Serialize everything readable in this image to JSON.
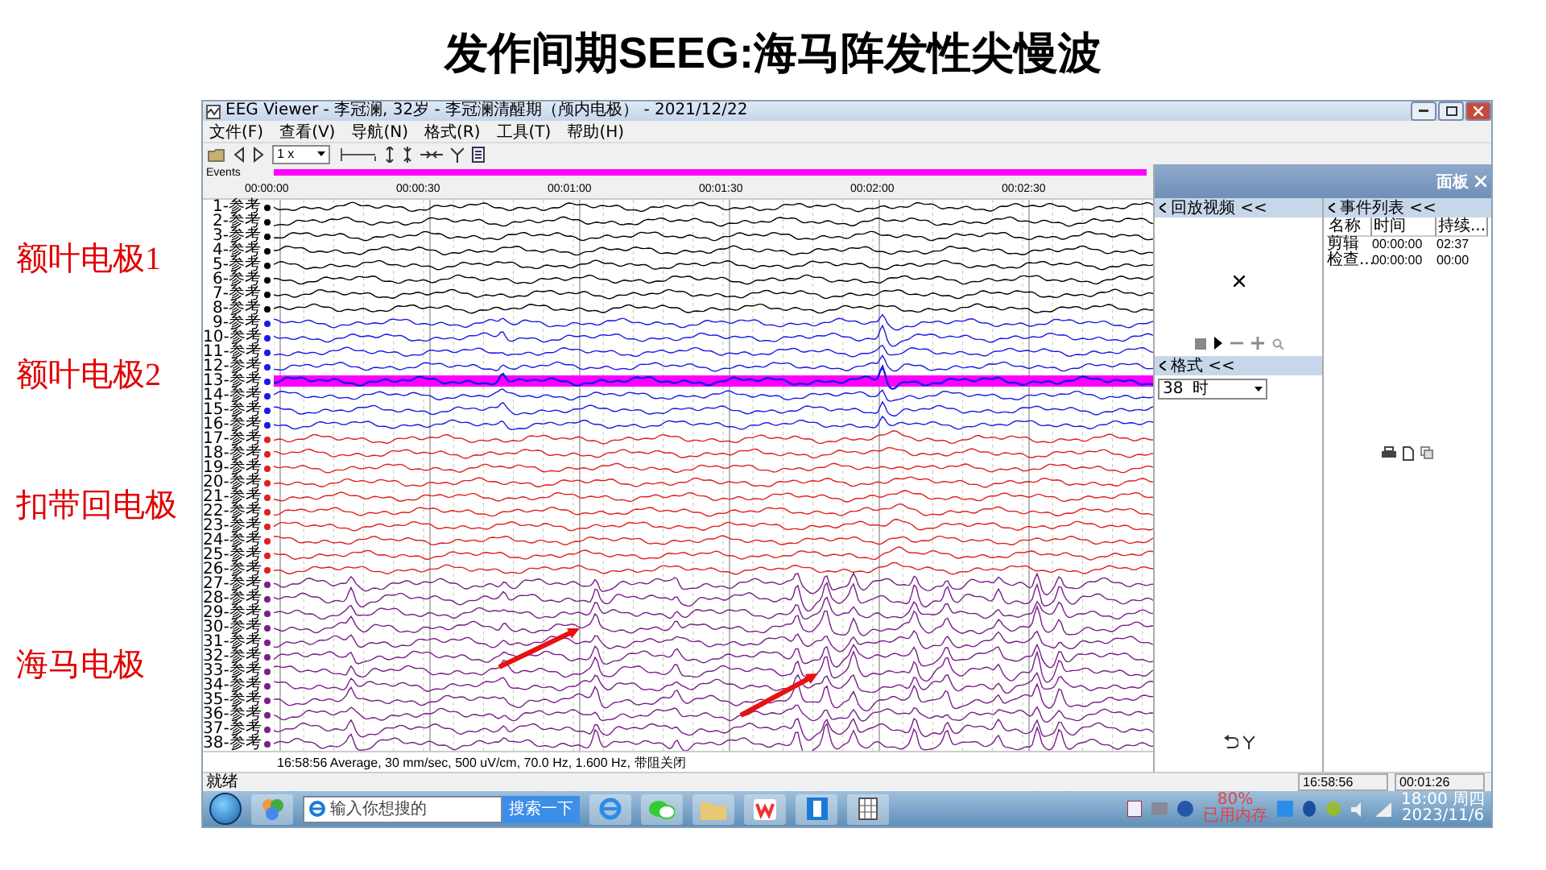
{
  "slide_title": "发作间期SEEG:海马阵发性尖慢波",
  "electrode_groups": [
    {
      "label": "额叶电极1",
      "color": "#000000",
      "channels": [
        {
          "label": "1-参考",
          "selected": false
        },
        {
          "label": "2-参考",
          "selected": false
        },
        {
          "label": "3-参考",
          "selected": false
        },
        {
          "label": "4-参考",
          "selected": false
        },
        {
          "label": "5-参考",
          "selected": false
        },
        {
          "label": "6-参考",
          "selected": false
        },
        {
          "label": "7-参考",
          "selected": false
        },
        {
          "label": "8-参考",
          "selected": false
        }
      ]
    },
    {
      "label": "额叶电极2",
      "color": "#1a1ae6",
      "channels": [
        {
          "label": "9-参考",
          "selected": false
        },
        {
          "label": "10-参考",
          "selected": false
        },
        {
          "label": "11-参考",
          "selected": false
        },
        {
          "label": "12-参考",
          "selected": false
        },
        {
          "label": "13-参考",
          "selected": true
        },
        {
          "label": "14-参考",
          "selected": false
        },
        {
          "label": "15-参考",
          "selected": false
        },
        {
          "label": "16-参考",
          "selected": false
        }
      ]
    },
    {
      "label": "扣带回电极",
      "color": "#e02020",
      "channels": [
        {
          "label": "17-参考",
          "selected": false
        },
        {
          "label": "18-参考",
          "selected": false
        },
        {
          "label": "19-参考",
          "selected": false
        },
        {
          "label": "20-参考",
          "selected": false
        },
        {
          "label": "21-参考",
          "selected": false
        },
        {
          "label": "22-参考",
          "selected": false
        },
        {
          "label": "23-参考",
          "selected": false
        },
        {
          "label": "24-参考",
          "selected": false
        },
        {
          "label": "25-参考",
          "selected": false
        },
        {
          "label": "26-参考",
          "selected": false
        }
      ]
    },
    {
      "label": "海马电极",
      "color": "#7a1f8a",
      "channels": [
        {
          "label": "27-参考",
          "selected": false
        },
        {
          "label": "28-参考",
          "selected": false
        },
        {
          "label": "29-参考",
          "selected": false
        },
        {
          "label": "30-参考",
          "selected": false
        },
        {
          "label": "31-参考",
          "selected": false
        },
        {
          "label": "32-参考",
          "selected": false
        },
        {
          "label": "33-参考",
          "selected": false
        },
        {
          "label": "34-参考",
          "selected": false
        },
        {
          "label": "35-参考",
          "selected": false
        },
        {
          "label": "36-参考",
          "selected": false
        },
        {
          "label": "37-参考",
          "selected": false
        },
        {
          "label": "38-参考",
          "selected": false
        }
      ]
    }
  ],
  "window": {
    "title": "EEG Viewer - 李冠澜, 32岁 - 李冠澜清醒期（颅内电极） - 2021/12/22",
    "menu": [
      "文件(F)",
      "查看(V)",
      "导航(N)",
      "格式(R)",
      "工具(T)",
      "帮助(H)"
    ],
    "speed": "1 x",
    "events_label": "Events",
    "time_ticks": [
      "00:00:00",
      "00:00:30",
      "00:01:00",
      "00:01:30",
      "00:02:00",
      "00:02:30"
    ],
    "status_line": "16:58:56 Average, 30 mm/sec, 500 uV/cm, 70.0 Hz, 1.600 Hz, 带阻关闭",
    "status_bar": {
      "text": "就绪",
      "time": "16:58:56",
      "elapsed": "00:01:26"
    }
  },
  "panel": {
    "title": "面板",
    "video": {
      "title": "回放视频 <<"
    },
    "format": {
      "title": "格式 <<",
      "value": "38",
      "unit": "时"
    },
    "events": {
      "title": "事件列表 <<",
      "columns": [
        "名称",
        "时间",
        "持续..."
      ],
      "rows": [
        [
          "剪辑",
          "00:00:00",
          "02:37"
        ],
        [
          "检查...",
          "00:00:00",
          "00:00"
        ]
      ]
    }
  },
  "taskbar": {
    "search_placeholder": "输入你想搜的",
    "search_button": "搜索一下",
    "memory_percent": "80%",
    "memory_label": "已用内存",
    "clock_time": "18:00 周四",
    "clock_date": "2023/11/6"
  }
}
